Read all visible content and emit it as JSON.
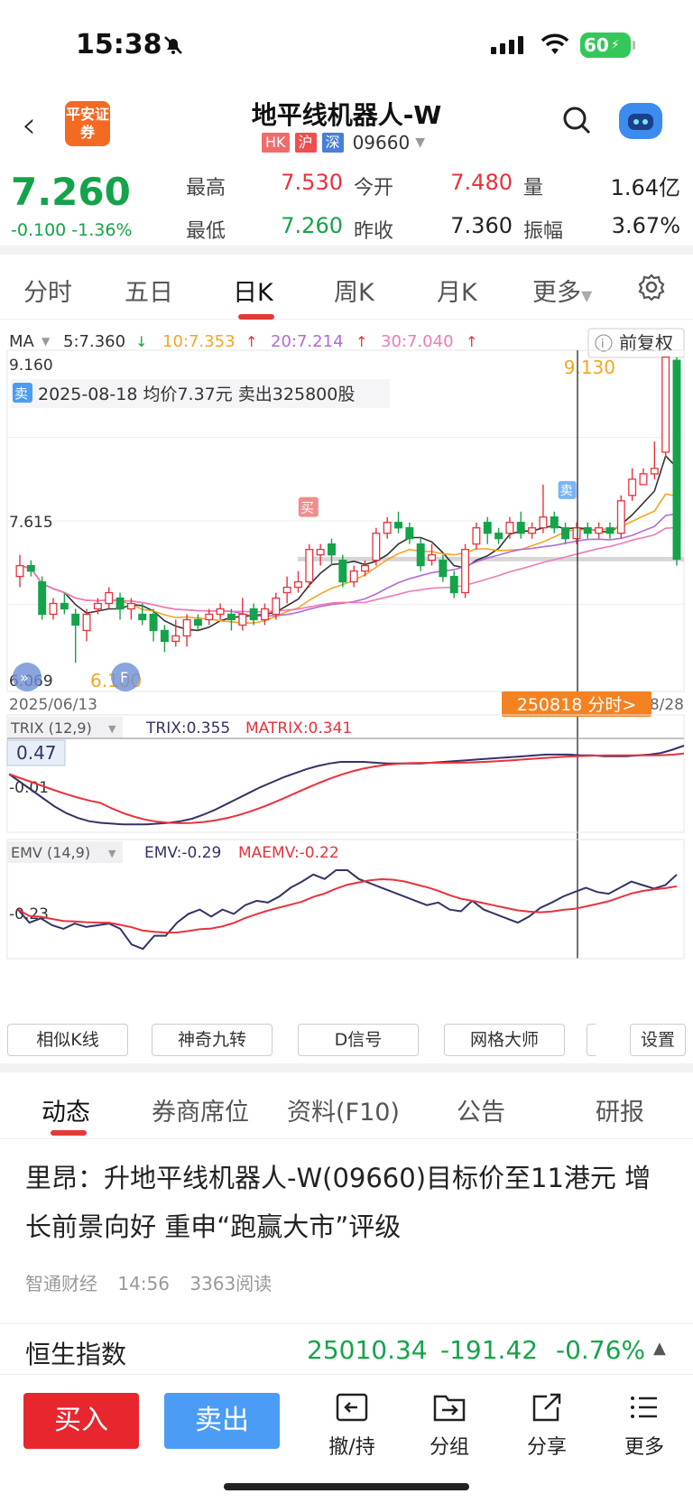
{
  "status_bar": {
    "time": "15:38",
    "battery": "60"
  },
  "header": {
    "broker_logo": "平安证券",
    "title": "地平线机器人-W",
    "tags": [
      {
        "text": "HK",
        "color": "#f26b6b"
      },
      {
        "text": "沪",
        "color": "#ef4e4e"
      },
      {
        "text": "深",
        "color": "#4a7fd8"
      }
    ],
    "code": "09660"
  },
  "quote": {
    "price": "7.260",
    "change": "-0.100",
    "change_pct": "-1.36%",
    "high_label": "最高",
    "high": "7.530",
    "low_label": "最低",
    "low": "7.260",
    "open_label": "今开",
    "open": "7.480",
    "prev_close_label": "昨收",
    "prev_close": "7.360",
    "volume_label": "量",
    "volume": "1.64亿",
    "amplitude_label": "振幅",
    "amplitude": "3.67%"
  },
  "kline_tabs": [
    "分时",
    "五日",
    "日K",
    "周K",
    "月K",
    "更多"
  ],
  "kline_active": "日K",
  "chart_data": {
    "type": "candlestick",
    "period": "日K",
    "ma_label": "MA",
    "ma_values": [
      {
        "name": "5",
        "value": "7.360",
        "dir": "down",
        "color": "#333333"
      },
      {
        "name": "10",
        "value": "7.353",
        "dir": "up",
        "color": "#f5a623"
      },
      {
        "name": "20",
        "value": "7.214",
        "dir": "up",
        "color": "#b36ad9"
      },
      {
        "name": "30",
        "value": "7.040",
        "dir": "up",
        "color": "#f07ab4"
      }
    ],
    "adjust": "前复权",
    "y_max_label": "9.160",
    "y_mid_label": "7.615",
    "y_min_label": "6.069",
    "high_marker": "9.130",
    "low_marker": "6.100",
    "start_date": "2025/06/13",
    "end_date_partial": "8/28",
    "annotation": "2025-08-18 均价7.37元 卖出325800股",
    "sell_tag": "卖",
    "buy_tag": "买",
    "cursor_label": "250818 分时>",
    "ylim": [
      6.069,
      9.16
    ],
    "candles": [
      [
        7.1,
        7.2,
        7.3,
        7.0
      ],
      [
        7.2,
        7.15,
        7.25,
        7.1
      ],
      [
        7.05,
        6.75,
        7.1,
        6.7
      ],
      [
        6.75,
        6.85,
        6.9,
        6.7
      ],
      [
        6.85,
        6.8,
        6.95,
        6.75
      ],
      [
        6.75,
        6.65,
        6.8,
        6.3
      ],
      [
        6.6,
        6.75,
        6.8,
        6.5
      ],
      [
        6.8,
        6.85,
        6.9,
        6.75
      ],
      [
        6.85,
        6.95,
        7.0,
        6.8
      ],
      [
        6.9,
        6.8,
        6.95,
        6.7
      ],
      [
        6.8,
        6.85,
        6.9,
        6.7
      ],
      [
        6.75,
        6.7,
        6.85,
        6.65
      ],
      [
        6.75,
        6.6,
        6.8,
        6.5
      ],
      [
        6.6,
        6.5,
        6.65,
        6.4
      ],
      [
        6.5,
        6.55,
        6.7,
        6.45
      ],
      [
        6.55,
        6.7,
        6.75,
        6.45
      ],
      [
        6.7,
        6.65,
        6.75,
        6.6
      ],
      [
        6.7,
        6.75,
        6.8,
        6.65
      ],
      [
        6.75,
        6.8,
        6.85,
        6.7
      ],
      [
        6.75,
        6.7,
        6.8,
        6.6
      ],
      [
        6.65,
        6.75,
        6.9,
        6.6
      ],
      [
        6.8,
        6.7,
        6.85,
        6.65
      ],
      [
        6.7,
        6.8,
        6.85,
        6.65
      ],
      [
        6.75,
        6.9,
        6.95,
        6.7
      ],
      [
        6.95,
        7.0,
        7.1,
        6.85
      ],
      [
        7.0,
        7.05,
        7.15,
        6.95
      ],
      [
        7.05,
        7.35,
        7.4,
        7.0
      ],
      [
        7.3,
        7.35,
        7.4,
        7.2
      ],
      [
        7.4,
        7.3,
        7.45,
        7.2
      ],
      [
        7.25,
        7.05,
        7.3,
        7.0
      ],
      [
        7.05,
        7.15,
        7.2,
        7.0
      ],
      [
        7.15,
        7.2,
        7.25,
        7.1
      ],
      [
        7.25,
        7.5,
        7.55,
        7.2
      ],
      [
        7.5,
        7.6,
        7.65,
        7.45
      ],
      [
        7.6,
        7.55,
        7.7,
        7.5
      ],
      [
        7.55,
        7.45,
        7.6,
        7.4
      ],
      [
        7.4,
        7.2,
        7.45,
        7.15
      ],
      [
        7.25,
        7.3,
        7.4,
        7.2
      ],
      [
        7.25,
        7.1,
        7.3,
        7.05
      ],
      [
        7.1,
        6.95,
        7.15,
        6.9
      ],
      [
        6.95,
        7.35,
        7.4,
        6.9
      ],
      [
        7.4,
        7.55,
        7.6,
        7.35
      ],
      [
        7.6,
        7.5,
        7.65,
        7.4
      ],
      [
        7.5,
        7.45,
        7.55,
        7.4
      ],
      [
        7.5,
        7.6,
        7.65,
        7.45
      ],
      [
        7.6,
        7.5,
        7.7,
        7.45
      ],
      [
        7.5,
        7.55,
        7.6,
        7.45
      ],
      [
        7.55,
        7.65,
        7.95,
        7.5
      ],
      [
        7.65,
        7.55,
        7.7,
        7.5
      ],
      [
        7.55,
        7.45,
        7.6,
        7.4
      ],
      [
        7.45,
        7.55,
        7.6,
        7.4
      ],
      [
        7.55,
        7.5,
        7.6,
        7.45
      ],
      [
        7.5,
        7.55,
        7.6,
        7.45
      ],
      [
        7.55,
        7.5,
        7.6,
        7.45
      ],
      [
        7.5,
        7.8,
        7.85,
        7.45
      ],
      [
        7.85,
        8.0,
        8.1,
        7.8
      ],
      [
        7.95,
        8.05,
        8.1,
        7.95
      ],
      [
        8.05,
        8.1,
        8.35,
        8.0
      ],
      [
        8.25,
        9.13,
        9.13,
        8.2
      ],
      [
        9.1,
        7.26,
        9.13,
        7.2
      ]
    ]
  },
  "trix": {
    "label": "TRIX (12,9)",
    "trix": "TRIX:0.355",
    "matrix": "MATRIX:0.341",
    "top": "0.47",
    "mid": "-0.01"
  },
  "emv": {
    "label": "EMV (14,9)",
    "emv": "EMV:-0.29",
    "maemv": "MAEMV:-0.22",
    "mid": "-0.23"
  },
  "tools": [
    "相似K线",
    "神奇九转",
    "D信号",
    "网格大师",
    "设置"
  ],
  "news_tabs": [
    "动态",
    "券商席位",
    "资料(F10)",
    "公告",
    "研报"
  ],
  "news_active": "动态",
  "news": {
    "headline": "里昂：升地平线机器人-W(09660)目标价至11港元 增长前景向好 重申“跑赢大市”评级",
    "source": "智通财经",
    "time": "14:56",
    "reads": "3363阅读"
  },
  "index": {
    "name": "恒生指数",
    "value": "25010.34",
    "change": "-191.42",
    "pct": "-0.76%"
  },
  "bottom": {
    "buy": "买入",
    "sell": "卖出",
    "cancel": "撤/持",
    "group": "分组",
    "share": "分享",
    "more": "更多"
  },
  "colors": {
    "up": "#e8323c",
    "down": "#15a34a",
    "accent": "#f58220",
    "sell_blue": "#4a9cf5"
  }
}
